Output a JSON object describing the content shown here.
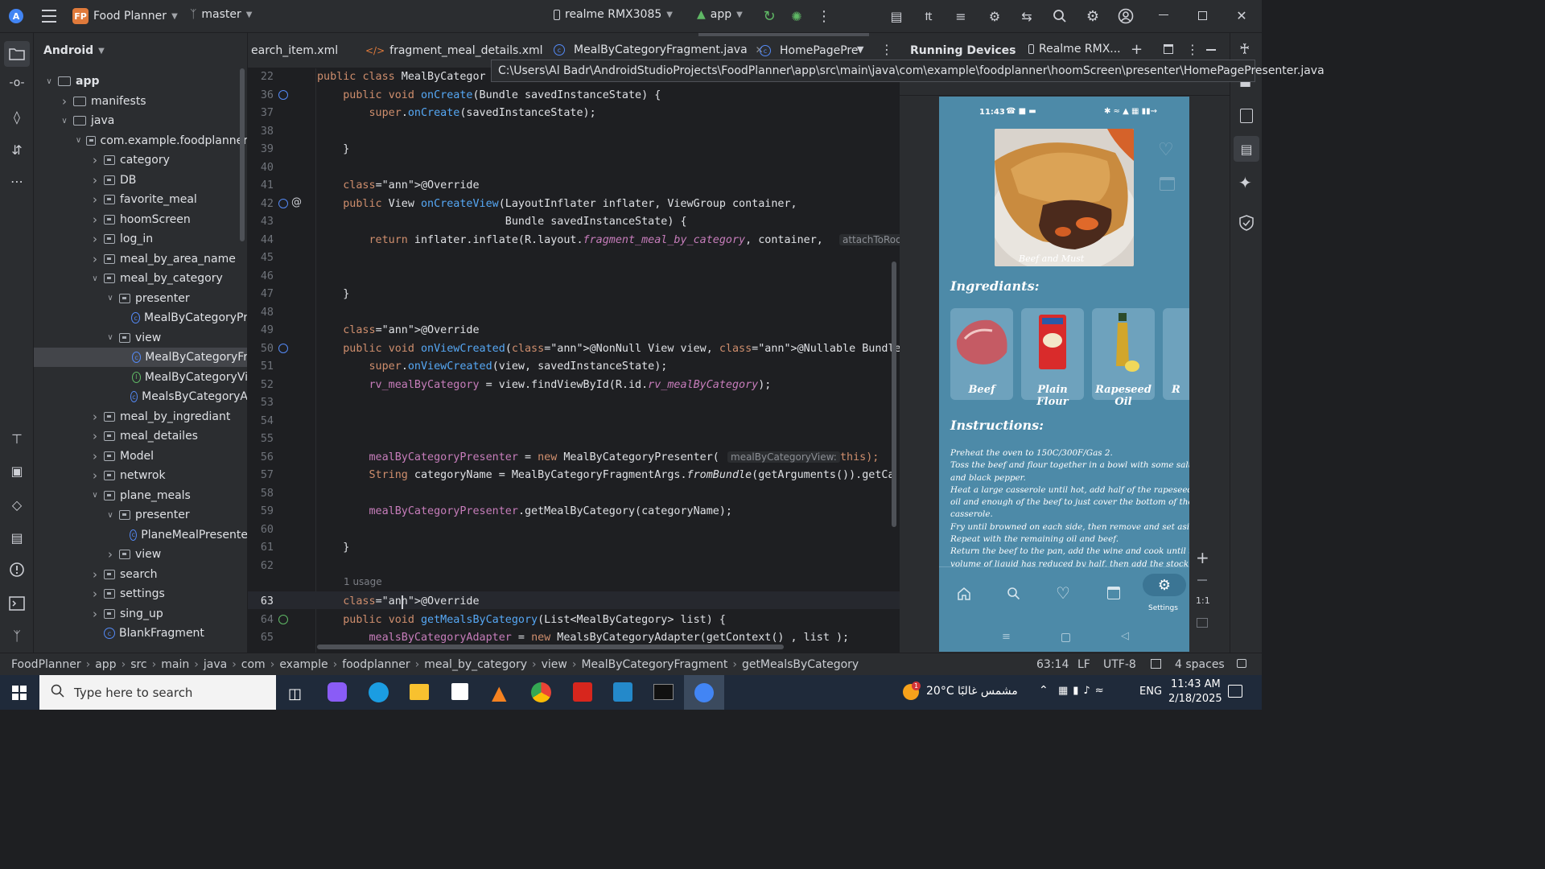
{
  "titlebar": {
    "project_badge": "FP",
    "project_name": "Food Planner",
    "branch": "master",
    "device": "realme RMX3085",
    "run_config": "app",
    "window_controls": [
      "minimize-icon",
      "restore-icon",
      "close-icon"
    ]
  },
  "project_panel": {
    "view_mode": "Android",
    "tree": [
      {
        "label": "app",
        "type": "module",
        "expanded": true
      },
      {
        "label": "manifests",
        "type": "folder",
        "expanded": false
      },
      {
        "label": "java",
        "type": "folder",
        "expanded": true
      },
      {
        "label": "com.example.foodplanner",
        "type": "package",
        "expanded": true
      },
      {
        "label": "category",
        "type": "package",
        "expanded": false
      },
      {
        "label": "DB",
        "type": "package",
        "expanded": false
      },
      {
        "label": "favorite_meal",
        "type": "package",
        "expanded": false
      },
      {
        "label": "hoomScreen",
        "type": "package",
        "expanded": false
      },
      {
        "label": "log_in",
        "type": "package",
        "expanded": false
      },
      {
        "label": "meal_by_area_name",
        "type": "package",
        "expanded": false
      },
      {
        "label": "meal_by_category",
        "type": "package",
        "expanded": true
      },
      {
        "label": "presenter",
        "type": "package",
        "expanded": true
      },
      {
        "label": "MealByCategoryPr",
        "type": "class"
      },
      {
        "label": "view",
        "type": "package",
        "expanded": true
      },
      {
        "label": "MealByCategoryFr",
        "type": "class",
        "selected": true
      },
      {
        "label": "MealByCategoryVi",
        "type": "interface"
      },
      {
        "label": "MealsByCategoryA",
        "type": "class"
      },
      {
        "label": "meal_by_ingrediant",
        "type": "package",
        "expanded": false
      },
      {
        "label": "meal_detailes",
        "type": "package",
        "expanded": false
      },
      {
        "label": "Model",
        "type": "package",
        "expanded": false
      },
      {
        "label": "netwrok",
        "type": "package",
        "expanded": false
      },
      {
        "label": "plane_meals",
        "type": "package",
        "expanded": true
      },
      {
        "label": "presenter",
        "type": "package",
        "expanded": true
      },
      {
        "label": "PlaneMealPresente",
        "type": "class"
      },
      {
        "label": "view",
        "type": "package",
        "expanded": false
      },
      {
        "label": "search",
        "type": "package",
        "expanded": false
      },
      {
        "label": "settings",
        "type": "package",
        "expanded": false
      },
      {
        "label": "sing_up",
        "type": "package",
        "expanded": false
      },
      {
        "label": "BlankFragment",
        "type": "class"
      }
    ]
  },
  "editor": {
    "tabs": [
      {
        "label": "earch_item.xml",
        "active": false
      },
      {
        "label": "fragment_meal_details.xml",
        "active": false
      },
      {
        "label": "MealByCategoryFragment.java",
        "active": true
      },
      {
        "label": "HomePagePre",
        "active": false
      }
    ],
    "path_tooltip": "C:\\Users\\Al Badr\\AndroidStudioProjects\\FoodPlanner\\app\\src\\main\\java\\com\\example\\foodplanner\\hoomScreen\\presenter\\HomePagePresenter.java",
    "usage_hint": "1 usage",
    "lines": [
      {
        "n": "22",
        "text": "public class MealByCategor"
      },
      {
        "n": "36",
        "text": "    public void onCreate(Bundle savedInstanceState) {"
      },
      {
        "n": "37",
        "text": "        super.onCreate(savedInstanceState);"
      },
      {
        "n": "38",
        "text": ""
      },
      {
        "n": "39",
        "text": "    }"
      },
      {
        "n": "40",
        "text": ""
      },
      {
        "n": "41",
        "text": "    @Override"
      },
      {
        "n": "42",
        "text": "    public View onCreateView(LayoutInflater inflater, ViewGroup container,"
      },
      {
        "n": "43",
        "text": "                             Bundle savedInstanceState) {"
      },
      {
        "n": "44",
        "text": "        return inflater.inflate(R.layout.fragment_meal_by_category, container,"
      },
      {
        "n": "45",
        "text": ""
      },
      {
        "n": "46",
        "text": ""
      },
      {
        "n": "47",
        "text": "    }"
      },
      {
        "n": "48",
        "text": ""
      },
      {
        "n": "49",
        "text": "    @Override"
      },
      {
        "n": "50",
        "text": "    public void onViewCreated(@NonNull View view, @Nullable Bundle savedInstanceState) {"
      },
      {
        "n": "51",
        "text": "        super.onViewCreated(view, savedInstanceState);"
      },
      {
        "n": "52",
        "text": "        rv_mealByCategory = view.findViewById(R.id.rv_mealByCategory);"
      },
      {
        "n": "53",
        "text": ""
      },
      {
        "n": "54",
        "text": ""
      },
      {
        "n": "55",
        "text": ""
      },
      {
        "n": "56",
        "text": "        mealByCategoryPresenter = new MealByCategoryPresenter("
      },
      {
        "n": "57",
        "text": "        String categoryName = MealByCategoryFragmentArgs.fromBundle(getArguments()).getCa"
      },
      {
        "n": "58",
        "text": ""
      },
      {
        "n": "59",
        "text": "        mealByCategoryPresenter.getMealByCategory(categoryName);"
      },
      {
        "n": "60",
        "text": ""
      },
      {
        "n": "61",
        "text": "    }"
      },
      {
        "n": "62",
        "text": ""
      },
      {
        "n": "63",
        "text": "    @Override"
      },
      {
        "n": "64",
        "text": "    public void getMealsByCategory(List<MealByCategory> list) {"
      },
      {
        "n": "65",
        "text": "        mealsByCategoryAdapter = new MealsByCategoryAdapter(getContext() , list );"
      }
    ],
    "inlay_hints": {
      "attach": "attachToRoo",
      "view_param": "mealByCategoryView:",
      "this_kw": "this);"
    }
  },
  "running_devices": {
    "title": "Running Devices",
    "device_tab": "Realme RMX...",
    "zoom_label": "1:1"
  },
  "phone": {
    "time": "11:43",
    "hero_caption": "Beef and Must",
    "ingredients_heading": "Ingrediants:",
    "ingredients": [
      "Beef",
      "Plain Flour",
      "Rapeseed Oil",
      "R"
    ],
    "instructions_heading": "Instructions:",
    "instructions": [
      "Preheat the oven to 150C/300F/Gas 2.",
      "Toss the beef and flour together in a bowl with some salt",
      "and black pepper.",
      "Heat a large casserole until hot, add half of the rapeseed",
      "oil and enough of the beef to just cover the bottom of the",
      "casserole.",
      "Fry until browned on each side, then remove and set aside.",
      "Repeat with the remaining oil and beef.",
      "Return the beef to the pan, add the wine and cook until the",
      "volume of liquid has reduced by half, then add the stock,"
    ],
    "nav_items": [
      "home-icon",
      "search-icon",
      "heart-icon",
      "calendar-icon",
      "settings-icon"
    ],
    "nav_active_label": "Settings"
  },
  "statusbar": {
    "breadcrumbs": [
      "FoodPlanner",
      "app",
      "src",
      "main",
      "java",
      "com",
      "example",
      "foodplanner",
      "meal_by_category",
      "view",
      "MealByCategoryFragment",
      "getMealsByCategory"
    ],
    "position": "63:14",
    "line_sep": "LF",
    "encoding": "UTF-8",
    "indent": "4 spaces"
  },
  "taskbar": {
    "search_placeholder": "Type here to search",
    "weather": "20°C  مشمس غالبًا",
    "lang": "ENG",
    "time": "11:43 AM",
    "date": "2/18/2025",
    "notification_count": "1"
  },
  "colors": {
    "accent": "#3574f0",
    "keyword": "#cf8e6d",
    "function": "#56a8f5",
    "annotation": "#b3ae60",
    "phone_bg": "#4d8aa8"
  }
}
